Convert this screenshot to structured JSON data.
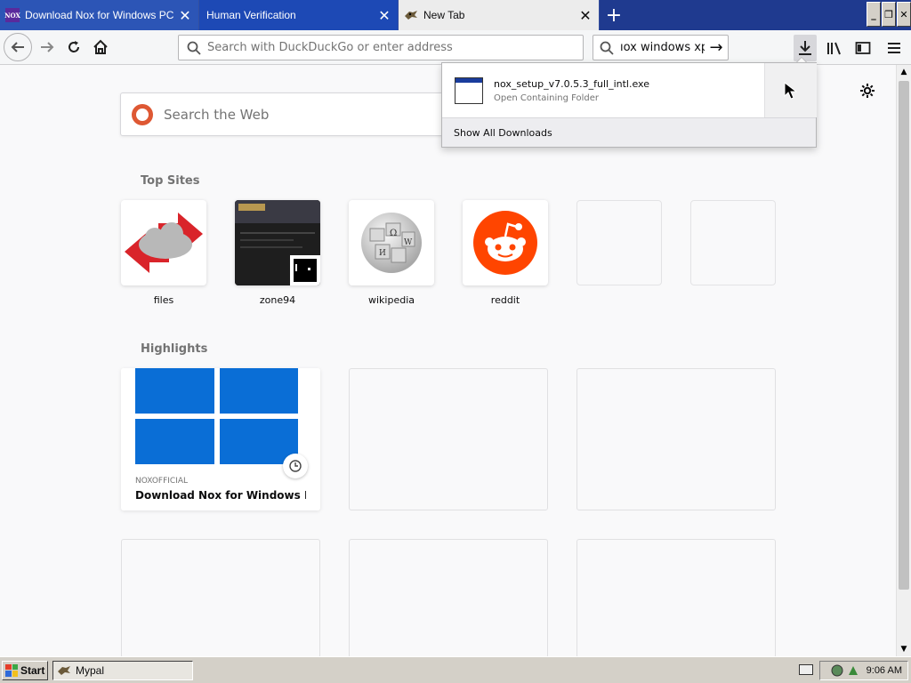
{
  "tabs": [
    {
      "title": "Download Nox for Windows PC - N",
      "favicon": "NOX"
    },
    {
      "title": "Human Verification"
    },
    {
      "title": "New Tab"
    }
  ],
  "window_controls": {
    "minimize": "_",
    "restore": "❐",
    "close": "✕"
  },
  "navbar": {
    "url_placeholder": "Search with DuckDuckGo or enter address",
    "search_value": "ıox windows xp"
  },
  "newtab": {
    "search_placeholder": "Search the Web",
    "top_sites_title": "Top Sites",
    "top_sites": [
      {
        "label": "files"
      },
      {
        "label": "zone94"
      },
      {
        "label": "wikipedia"
      },
      {
        "label": "reddit"
      },
      {
        "label": ""
      },
      {
        "label": ""
      }
    ],
    "highlights_title": "Highlights",
    "highlights": [
      {
        "source": "NOXOFFICIAL",
        "title": "Download Nox for Windows PC -..."
      }
    ]
  },
  "downloads": {
    "file_name": "nox_setup_v7.0.5.3_full_intl.exe",
    "status": "Open Containing Folder",
    "show_all": "Show All Downloads"
  },
  "taskbar": {
    "start": "Start",
    "task": "Mypal",
    "clock": "9:06 AM"
  },
  "colors": {
    "accent": "#1f3a8f",
    "windows_blue": "#0a6ed6",
    "reddit": "#ff4500",
    "duckduckgo": "#de5833"
  }
}
